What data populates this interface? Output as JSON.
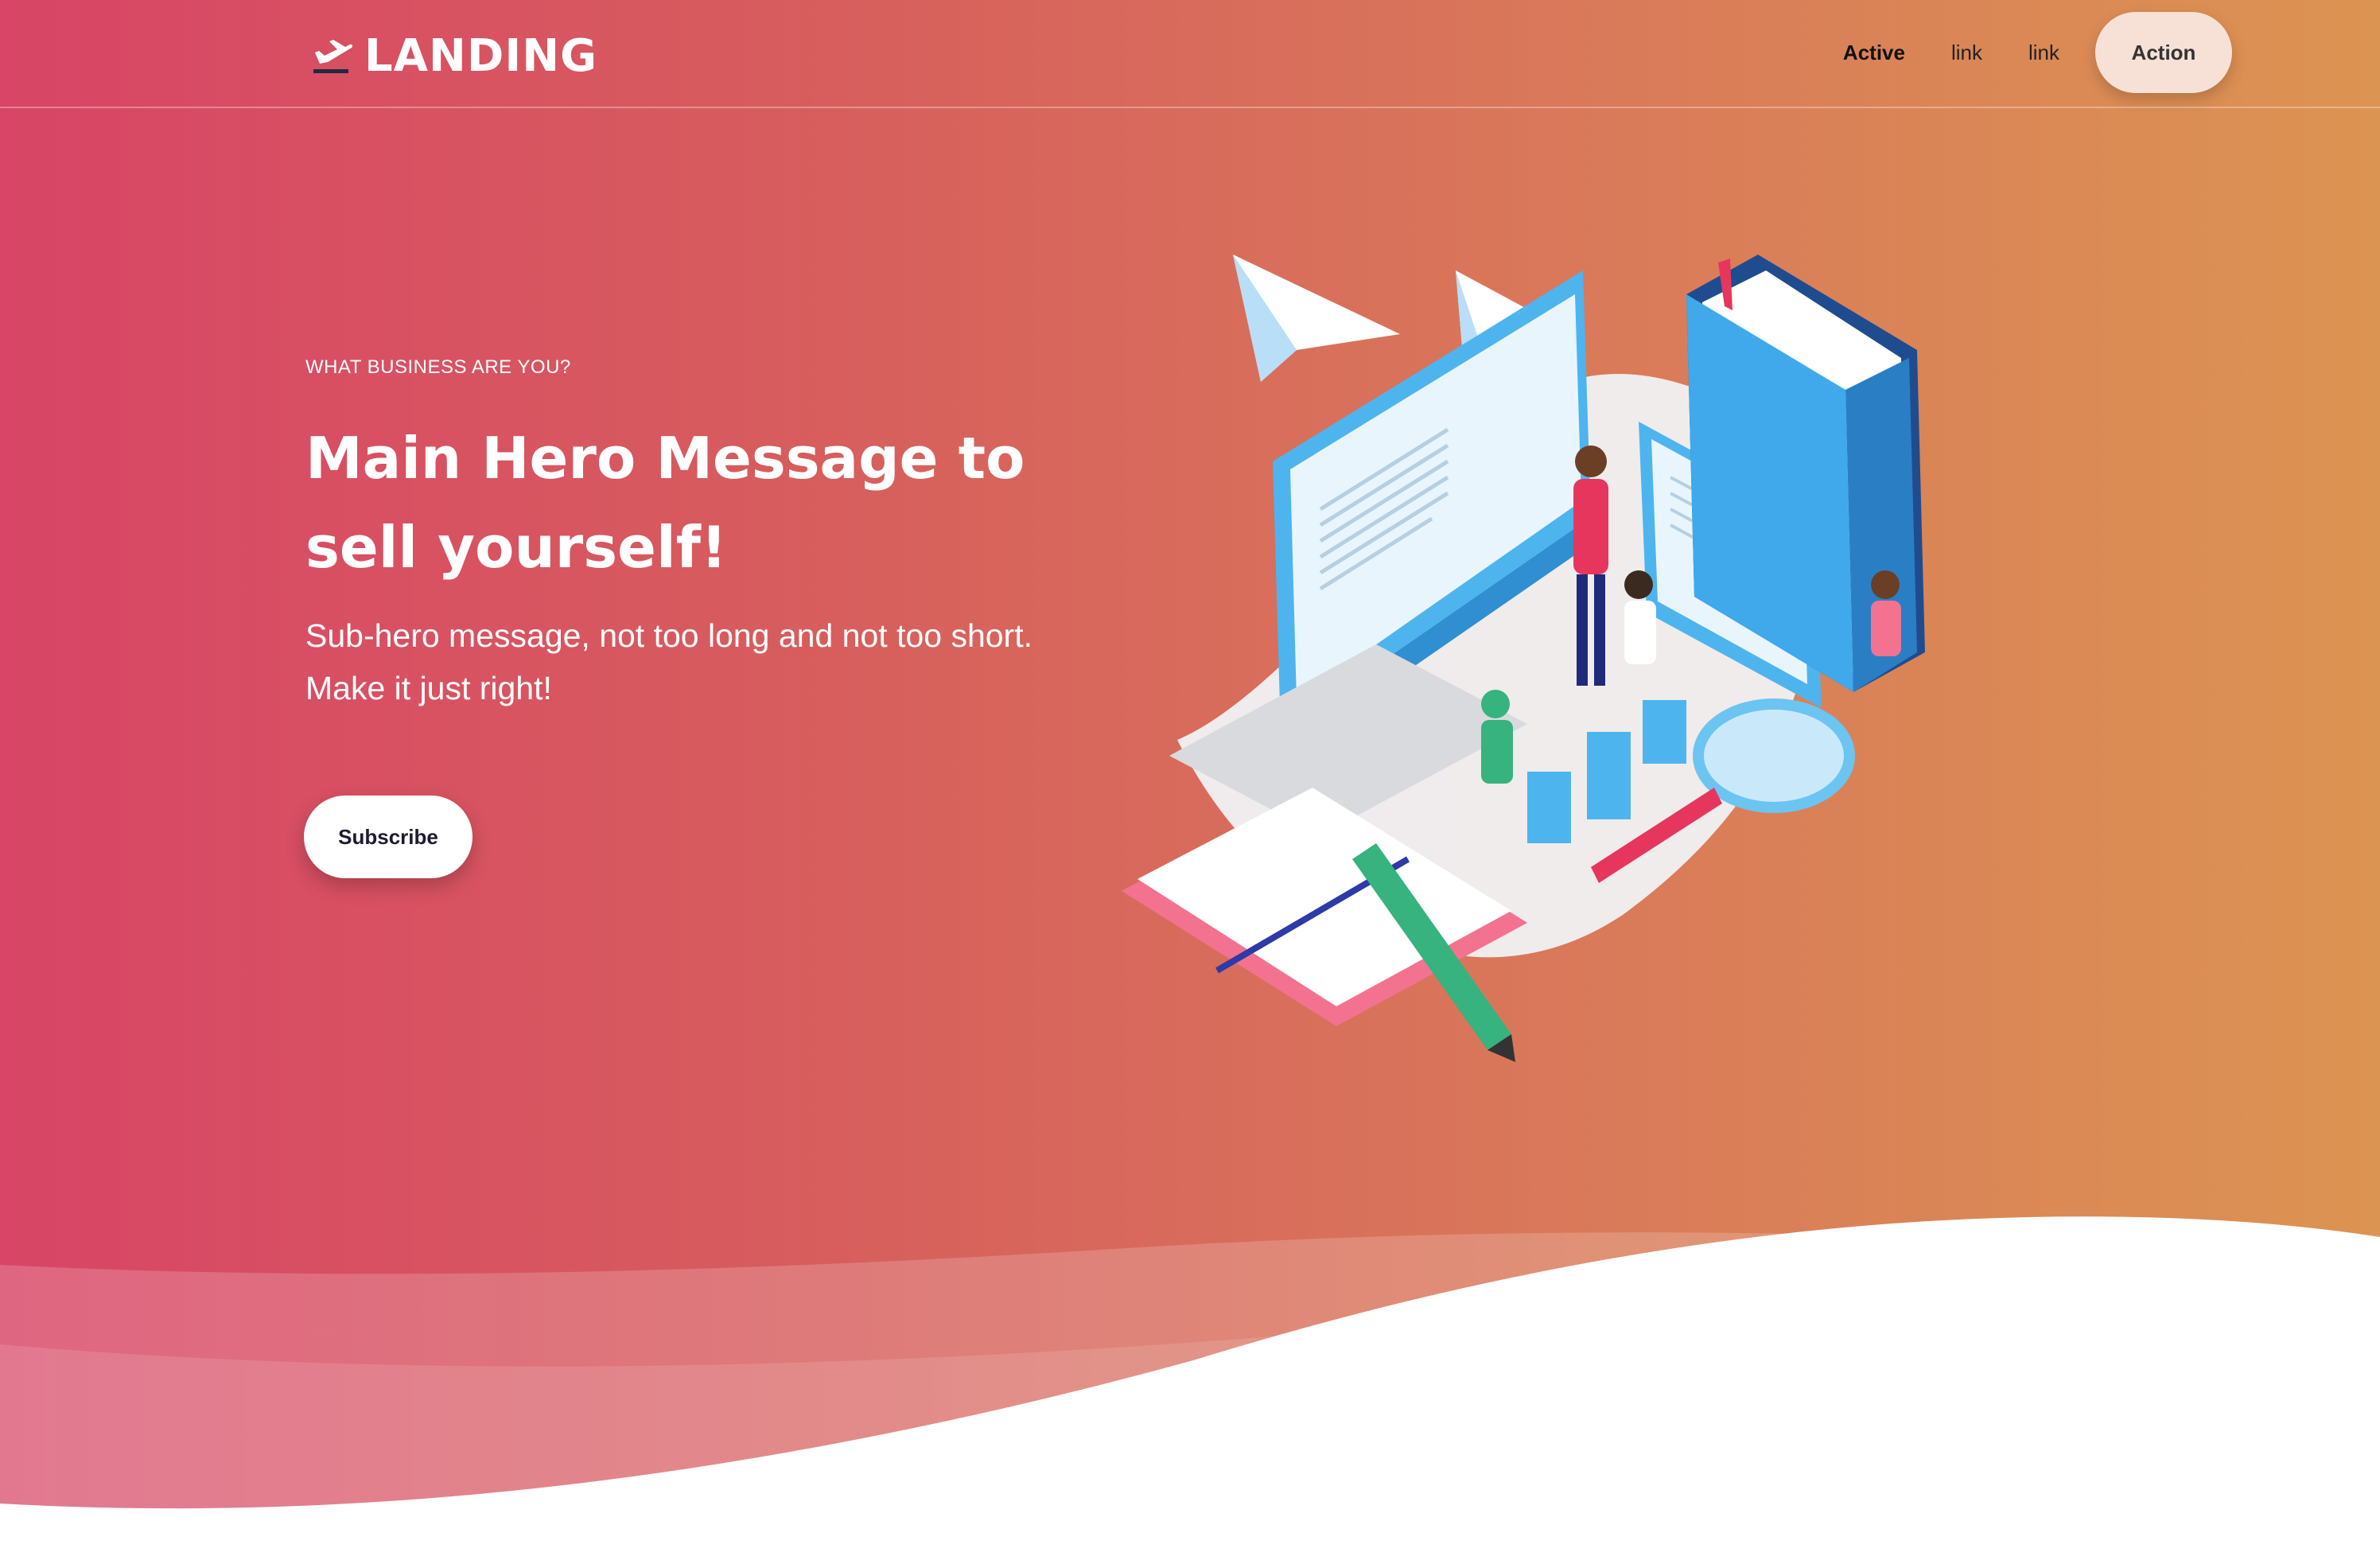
{
  "navbar": {
    "brand": {
      "icon": "plane-departure-icon",
      "label": "LANDING"
    },
    "links": [
      {
        "label": "Active",
        "active": true
      },
      {
        "label": "link",
        "active": false
      },
      {
        "label": "link",
        "active": false
      }
    ],
    "action_label": "Action"
  },
  "hero": {
    "eyebrow": "WHAT BUSINESS ARE YOU?",
    "headline": "Main Hero Message to sell yourself!",
    "subheadline": "Sub-hero message, not too long and not too short. Make it just right!",
    "subscribe_label": "Subscribe",
    "illustration": "isometric-study-illustration"
  },
  "colors": {
    "gradient_start": "#d84566",
    "gradient_end": "#dc9452",
    "action_button_bg": "#f7e1d6",
    "wave_fill": "#ffffff"
  }
}
